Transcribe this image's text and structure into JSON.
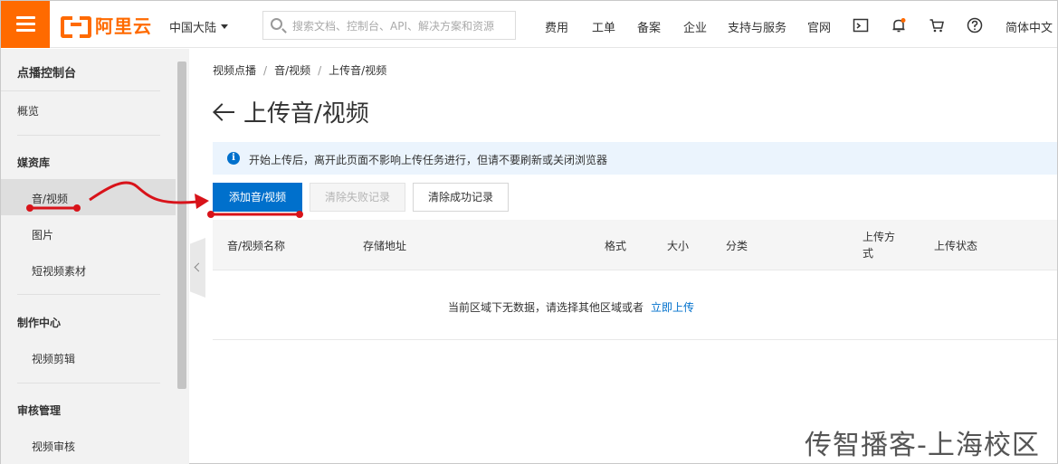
{
  "header": {
    "logo_text": "阿里云",
    "region": "中国大陆",
    "search_placeholder": "搜索文档、控制台、API、解决方案和资源",
    "nav": [
      "费用",
      "工单",
      "备案",
      "企业",
      "支持与服务",
      "官网"
    ],
    "language": "简体中文",
    "brand_color": "#ff6a00"
  },
  "sidebar": {
    "title": "点播控制台",
    "overview": "概览",
    "groups": [
      {
        "label": "媒资库",
        "items": [
          "音/视频",
          "图片",
          "短视频素材"
        ]
      },
      {
        "label": "制作中心",
        "items": [
          "视频剪辑"
        ]
      },
      {
        "label": "审核管理",
        "items": [
          "视频审核"
        ]
      }
    ],
    "active_item": "音/视频"
  },
  "main": {
    "breadcrumb": [
      "视频点播",
      "音/视频",
      "上传音/视频"
    ],
    "title": "上传音/视频",
    "notice": "开始上传后，离开此页面不影响上传任务进行，但请不要刷新或关闭浏览器",
    "buttons": {
      "add": "添加音/视频",
      "clear_failed": "清除失败记录",
      "clear_success": "清除成功记录"
    },
    "table": {
      "columns": [
        "音/视频名称",
        "存储地址",
        "格式",
        "大小",
        "分类",
        "上传方式",
        "上传状态"
      ],
      "empty_text": "当前区域下无数据，请选择其他区域或者",
      "empty_link": "立即上传"
    },
    "primary_color": "#0070cc"
  },
  "watermark": "传智播客-上海校区"
}
